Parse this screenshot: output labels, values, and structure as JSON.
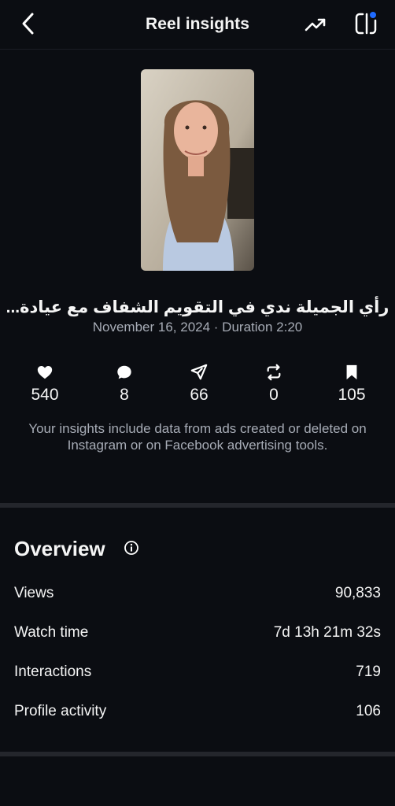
{
  "header": {
    "title": "Reel insights"
  },
  "reel": {
    "title": "رأي الجميلة ندي في التقويم الشفاف مع عيادة...",
    "meta": "November 16, 2024 · Duration 2:20"
  },
  "stats": {
    "likes": "540",
    "comments": "8",
    "shares": "66",
    "reposts": "0",
    "saves": "105"
  },
  "note": "Your insights include data from ads created or deleted on Instagram or on Facebook advertising tools.",
  "overview": {
    "title": "Overview",
    "rows": [
      {
        "label": "Views",
        "value": "90,833"
      },
      {
        "label": "Watch time",
        "value": "7d 13h 21m 32s"
      },
      {
        "label": "Interactions",
        "value": "719"
      },
      {
        "label": "Profile activity",
        "value": "106"
      }
    ]
  },
  "colors": {
    "background": "#0b0d12",
    "secondary_text": "#a7acb6",
    "divider": "#24262c",
    "accent_dot": "#1f6bff"
  }
}
